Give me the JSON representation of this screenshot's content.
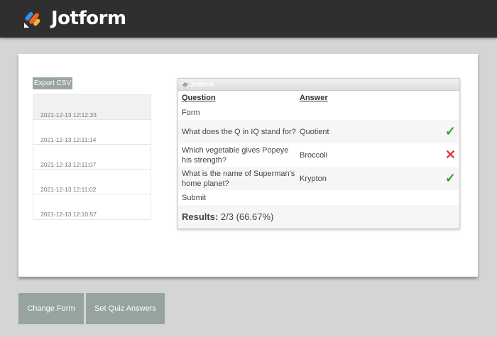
{
  "header": {
    "brand": "Jotform"
  },
  "export_label": "Export CSV",
  "submissions": [
    "2021-12-13 12:12:33",
    "2021-12-13 12:11:14",
    "2021-12-13 12:11:07",
    "2021-12-13 12:11:02",
    "2021-12-13 12:10:57"
  ],
  "quiz": {
    "title": "Jotform",
    "col_question": "Question",
    "col_answer": "Answer",
    "form_label": "Form",
    "rows": [
      {
        "question": "What does the Q in IQ stand for?",
        "answer": "Quotient",
        "result": "correct"
      },
      {
        "question": "Which vegetable gives Popeye his strength?",
        "answer": "Broccoli",
        "result": "incorrect"
      },
      {
        "question": "What is the name of Superman's home planet?",
        "answer": "Krypton",
        "result": "correct"
      }
    ],
    "submit_label": "Submit",
    "results_label": "Results:",
    "results_value": "2/3 (66.67%)"
  },
  "icons": {
    "correct": "✓",
    "incorrect": "✕",
    "correct_color": "#22aa22",
    "incorrect_color": "#dd3333"
  },
  "buttons": {
    "change_form": "Change Form",
    "set_quiz_answers": "Set Quiz Answers"
  }
}
